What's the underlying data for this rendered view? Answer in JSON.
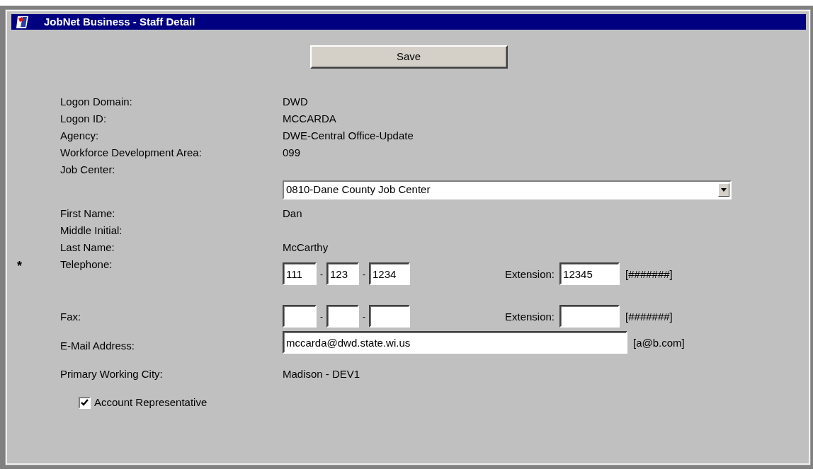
{
  "window": {
    "title": "JobNet Business - Staff Detail"
  },
  "save_button": {
    "label": "Save"
  },
  "fields": [
    {
      "kind": "text",
      "label": "Logon Domain:",
      "value": "DWD"
    },
    {
      "kind": "text",
      "label": "Logon ID:",
      "value": "MCCARDA"
    },
    {
      "kind": "text",
      "label": "Agency:",
      "value": "DWE-Central Office-Update"
    },
    {
      "kind": "text",
      "label": "Workforce Development Area:",
      "value": "099"
    },
    {
      "kind": "select",
      "label": "Job Center:",
      "value": "0810-Dane County Job Center"
    },
    {
      "kind": "text",
      "label": "First Name:",
      "value": "Dan"
    },
    {
      "kind": "text",
      "label": "Middle Initial:"
    },
    {
      "kind": "text",
      "label": "Last Name:",
      "value": "McCarthy"
    },
    {
      "kind": "phone",
      "label": "Telephone:",
      "required": true,
      "required_mark": "*",
      "parts": [
        "111",
        "123",
        "1234"
      ],
      "separators": [
        "-",
        "-"
      ],
      "extension_label": "Extension:",
      "extension": "12345",
      "format_hint": "[#######]"
    },
    {
      "kind": "phone",
      "label": "Fax:",
      "required": false,
      "separators": [
        "-",
        "-"
      ],
      "extension_label": "Extension:",
      "format_hint": "[#######]"
    },
    {
      "kind": "email",
      "label": "E-Mail Address:",
      "value": "mccarda@dwd.state.wi.us",
      "format_hint": "[a@b.com]"
    },
    {
      "kind": "text",
      "label": "Primary Working City:",
      "value": "Madison - DEV1"
    }
  ],
  "checkbox": {
    "label": "Account Representative",
    "checked": true
  }
}
